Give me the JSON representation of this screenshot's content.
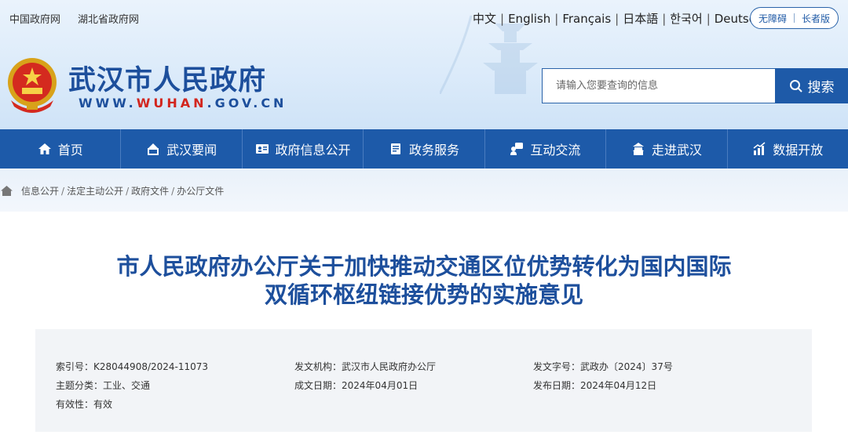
{
  "top_links": [
    "中国政府网",
    "湖北省政府网"
  ],
  "languages": [
    "中文",
    "English",
    "Français",
    "日本語",
    "한국어",
    "Deutsch"
  ],
  "accessibility": {
    "barrier_free": "无障碍",
    "elder": "长者版"
  },
  "site": {
    "title": "武汉市人民政府",
    "url_prefix": "WWW.",
    "url_mid": "WUHAN",
    "url_suffix": ".GOV.CN"
  },
  "search": {
    "placeholder": "请输入您要查询的信息",
    "button": "搜索"
  },
  "nav": [
    {
      "label": "首页",
      "icon": "home-icon"
    },
    {
      "label": "武汉要闻",
      "icon": "news-icon"
    },
    {
      "label": "政府信息公开",
      "icon": "info-card-icon"
    },
    {
      "label": "政务服务",
      "icon": "service-icon"
    },
    {
      "label": "互动交流",
      "icon": "chat-icon"
    },
    {
      "label": "走进武汉",
      "icon": "building-icon"
    },
    {
      "label": "数据开放",
      "icon": "chart-icon"
    }
  ],
  "breadcrumb": [
    "信息公开",
    "法定主动公开",
    "政府文件",
    "办公厅文件"
  ],
  "article": {
    "title_line1": "市人民政府办公厅关于加快推动交通区位优势转化为国内国际",
    "title_line2": "双循环枢纽链接优势的实施意见"
  },
  "meta": {
    "index_label": "索引号：",
    "index_value": "K28044908/2024-11073",
    "issuer_label": "发文机构：",
    "issuer_value": "武汉市人民政府办公厅",
    "doc_no_label": "发文字号：",
    "doc_no_value": "武政办〔2024〕37号",
    "topic_label": "主题分类：",
    "topic_value": "工业、交通",
    "written_label": "成文日期：",
    "written_value": "2024年04月01日",
    "published_label": "发布日期：",
    "published_value": "2024年04月12日",
    "validity_label": "有效性：",
    "validity_value": "有效"
  }
}
